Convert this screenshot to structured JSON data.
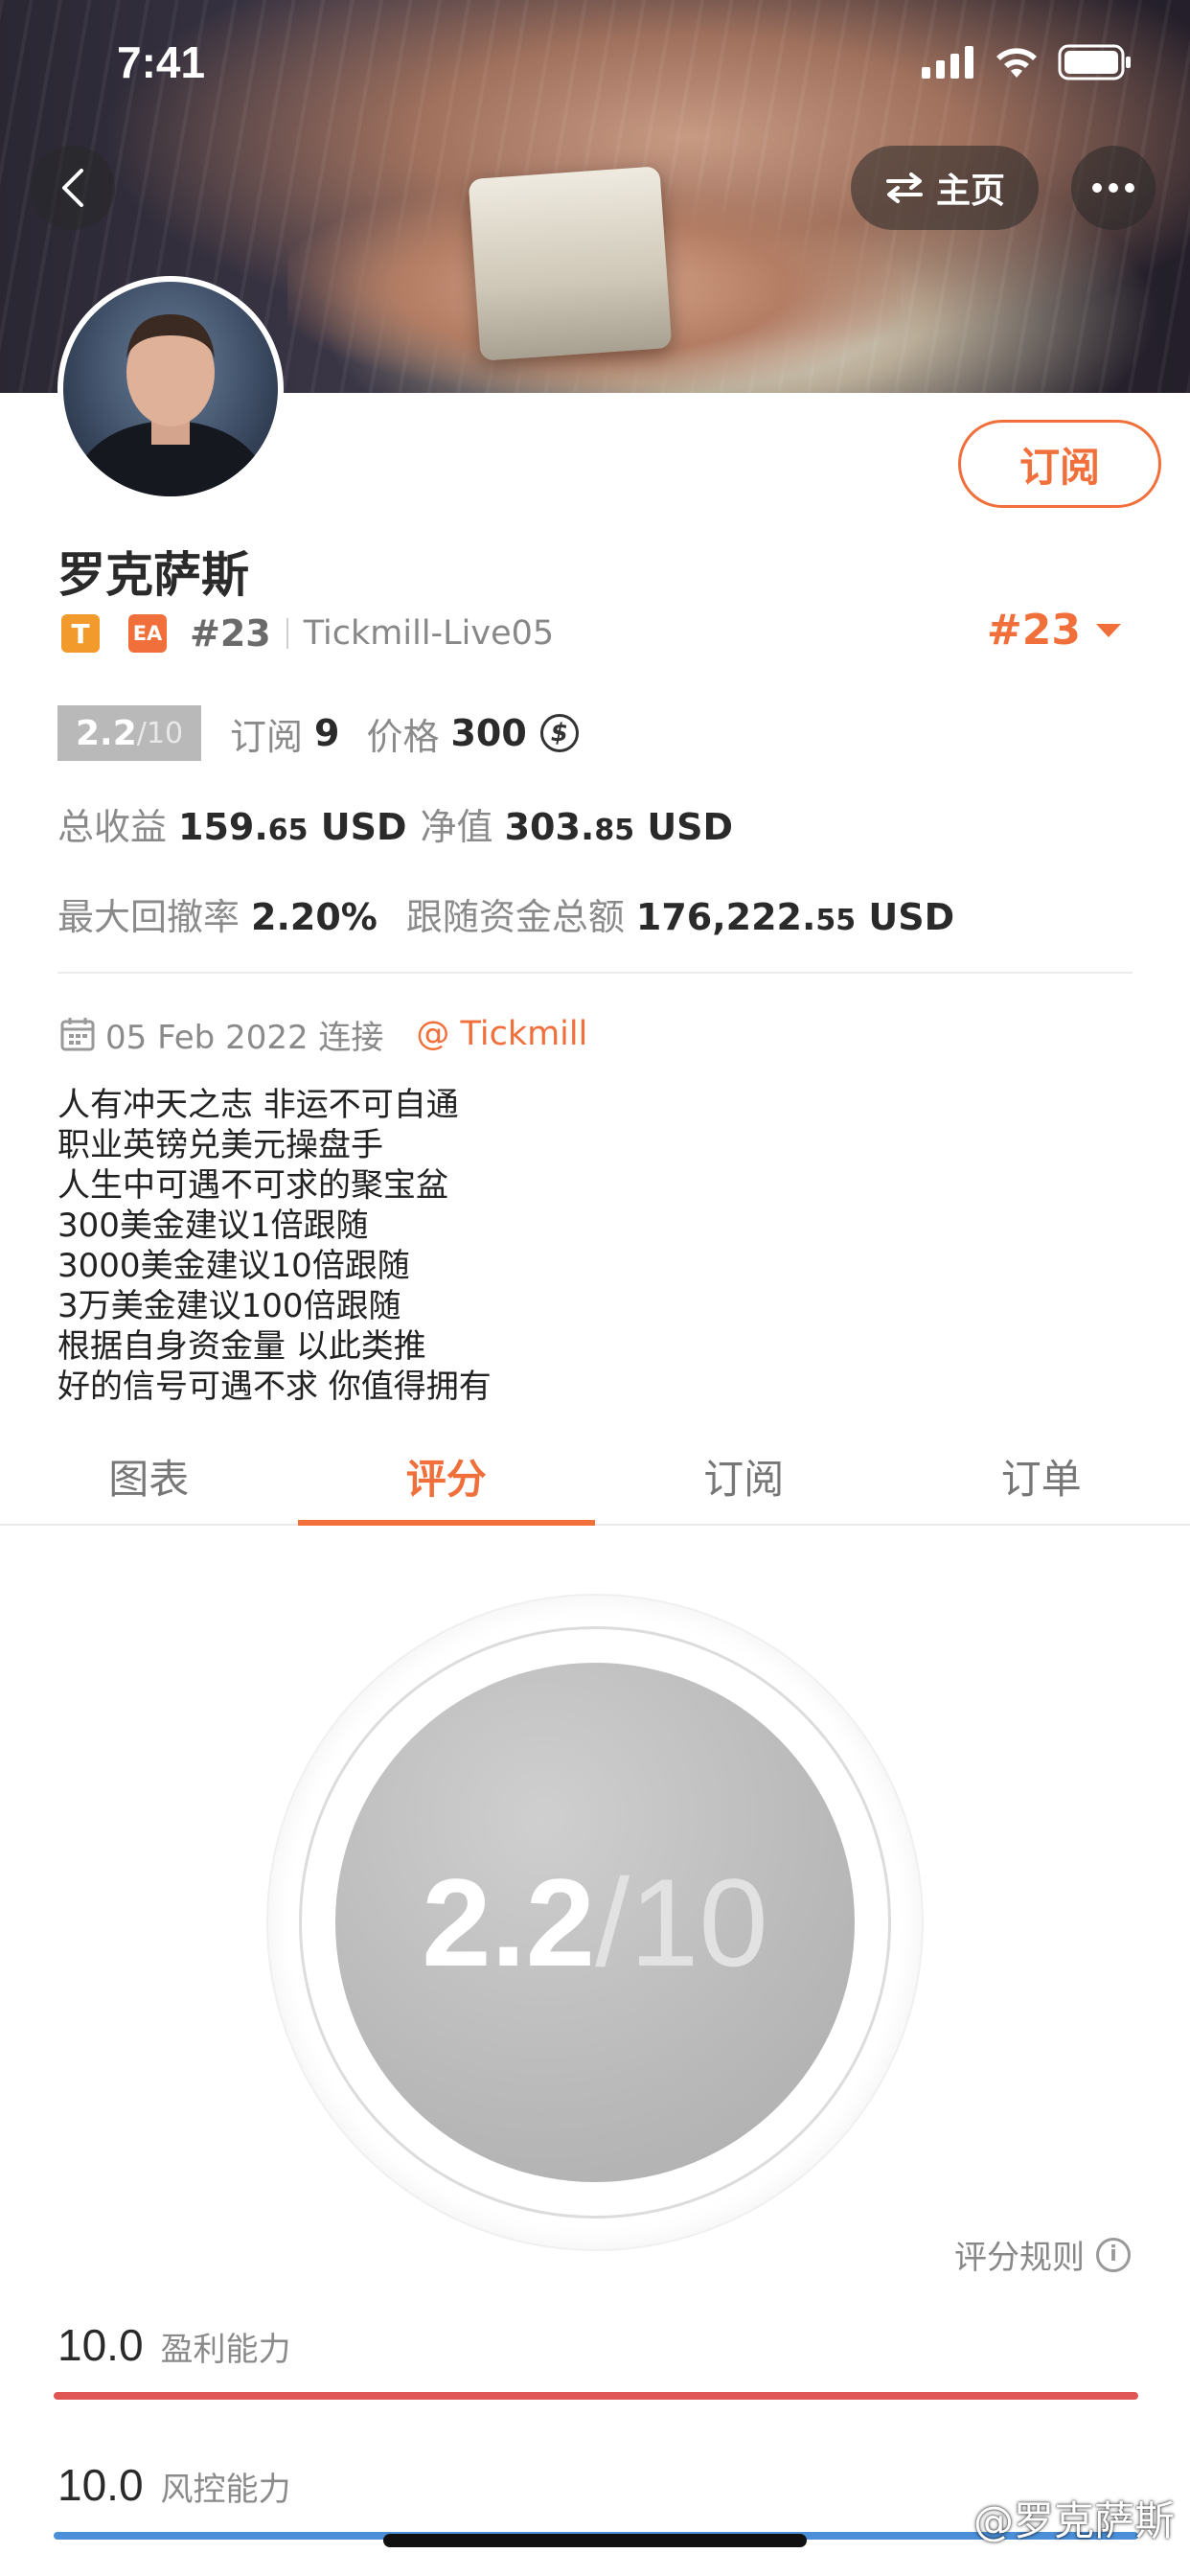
{
  "status_bar": {
    "time": "7:41"
  },
  "nav": {
    "home_label": "主页"
  },
  "profile": {
    "name": "罗克萨斯",
    "subscribe_label": "订阅",
    "tag_t": "T",
    "tag_ea": "EA",
    "rank": "#23",
    "server": "Tickmill-Live05",
    "rank_big": "#23"
  },
  "score": {
    "value": "2.2",
    "denominator": "/10",
    "subscribe_label": "订阅",
    "subscribe_count": "9",
    "price_label": "价格",
    "price_value": "300",
    "currency_symbol": "$"
  },
  "stats": {
    "total_profit_label": "总收益",
    "total_profit_main": "159.",
    "total_profit_dec": "65",
    "total_profit_unit": "USD",
    "equity_label": "净值",
    "equity_main": "303.",
    "equity_dec": "85",
    "equity_unit": "USD",
    "drawdown_label": "最大回撤率",
    "drawdown_value": "2.20%",
    "follow_label": "跟随资金总额",
    "follow_main": "176,222.",
    "follow_dec": "55",
    "follow_unit": "USD"
  },
  "meta": {
    "date": "05 Feb 2022 连接",
    "broker": "@ Tickmill"
  },
  "bio": [
    "人有冲天之志 非运不可自通",
    "职业英镑兑美元操盘手",
    "人生中可遇不可求的聚宝盆",
    "300美金建议1倍跟随",
    "3000美金建议10倍跟随",
    "3万美金建议100倍跟随",
    "根据自身资金量 以此类推",
    "好的信号可遇不求 你值得拥有"
  ],
  "tabs": [
    {
      "label": "图表",
      "active": false
    },
    {
      "label": "评分",
      "active": true
    },
    {
      "label": "订阅",
      "active": false
    },
    {
      "label": "订单",
      "active": false
    }
  ],
  "rating": {
    "score": "2.2",
    "denominator": "/10",
    "rules_label": "评分规则",
    "abilities": [
      {
        "value": "10.0",
        "label": "盈利能力",
        "color": "#e05555",
        "fill": 1.0
      },
      {
        "value": "10.0",
        "label": "风控能力",
        "color": "#4a8fd8",
        "fill": 1.0
      }
    ]
  },
  "watermark": "@罗克萨斯",
  "colors": {
    "accent": "#f06f3a",
    "text": "#2a2a2a",
    "muted": "#8a8a8a"
  }
}
